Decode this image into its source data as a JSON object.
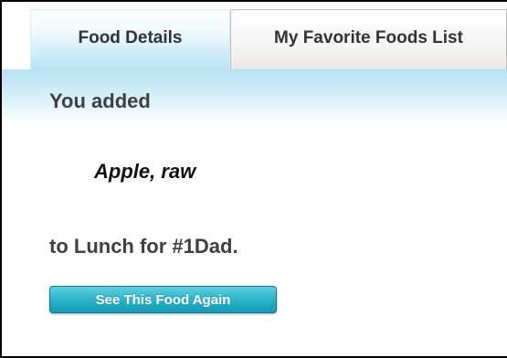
{
  "tabs": [
    {
      "label": "Food Details",
      "active": true
    },
    {
      "label": "My Favorite Foods List",
      "active": false
    }
  ],
  "confirmation": {
    "headline": "You added",
    "food_name": "Apple, raw",
    "meal_line": "to Lunch for #1Dad."
  },
  "actions": {
    "see_again_label": "See This Food Again"
  },
  "colors": {
    "accent": "#2cb2c9",
    "band": "#b8e3f4",
    "text": "#404040"
  }
}
